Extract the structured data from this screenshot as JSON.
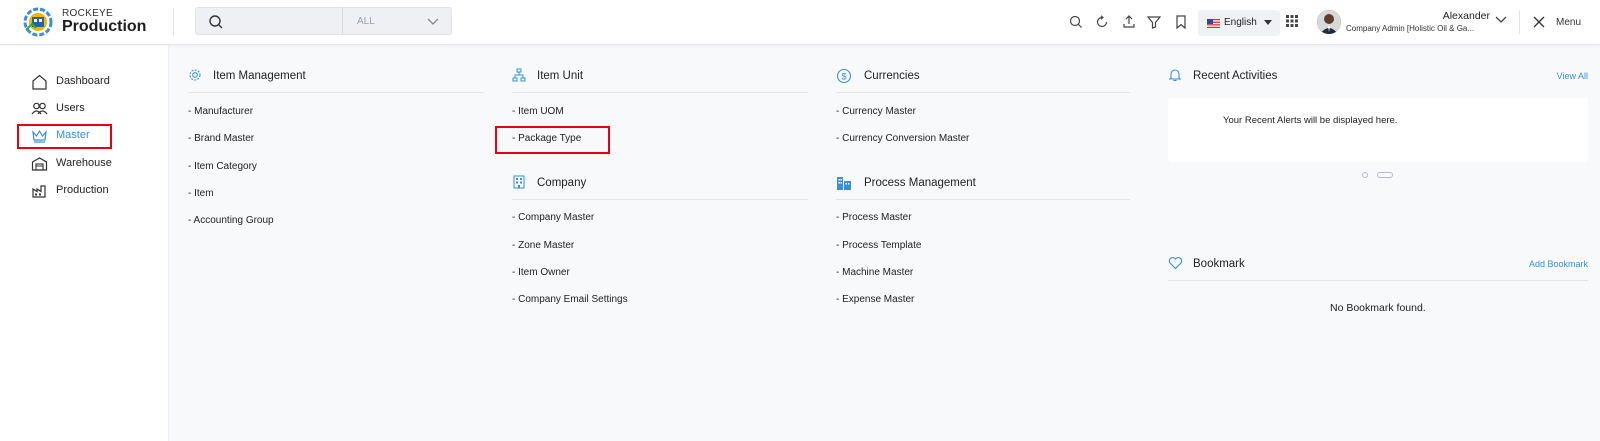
{
  "brand": {
    "top": "ROCKEYE",
    "main": "Production"
  },
  "search": {
    "filter": "ALL"
  },
  "language": {
    "label": "English"
  },
  "user": {
    "name": "Alexander",
    "role": "Company Admin [Holistic Oil & Ga..."
  },
  "menu_label": "Menu",
  "sidebar": {
    "items": [
      {
        "label": "Dashboard",
        "icon": "home-icon"
      },
      {
        "label": "Users",
        "icon": "users-icon"
      },
      {
        "label": "Master",
        "icon": "crown-icon",
        "active": true
      },
      {
        "label": "Warehouse",
        "icon": "warehouse-icon"
      },
      {
        "label": "Production",
        "icon": "factory-icon"
      }
    ]
  },
  "sections": {
    "item_management": {
      "title": "Item Management",
      "links": [
        "- Manufacturer",
        "- Brand Master",
        "- Item Category",
        "- Item",
        "- Accounting Group"
      ]
    },
    "item_unit": {
      "title": "Item Unit",
      "links": [
        "- Item UOM",
        "- Package Type"
      ]
    },
    "currencies": {
      "title": "Currencies",
      "links": [
        "- Currency Master",
        "- Currency Conversion Master"
      ]
    },
    "company": {
      "title": "Company",
      "links": [
        "- Company Master",
        "- Zone Master",
        "- Item Owner",
        "- Company Email Settings"
      ]
    },
    "process_management": {
      "title": "Process Management",
      "links": [
        "- Process Master",
        "- Process Template",
        "- Machine Master",
        "- Expense Master"
      ]
    }
  },
  "recent": {
    "title": "Recent Activities",
    "view_all": "View All",
    "empty": "Your Recent Alerts will be displayed here."
  },
  "bookmark": {
    "title": "Bookmark",
    "add": "Add Bookmark",
    "empty": "No Bookmark found."
  },
  "colors": {
    "accent": "#3a8fd8",
    "highlight": "#e60012"
  }
}
